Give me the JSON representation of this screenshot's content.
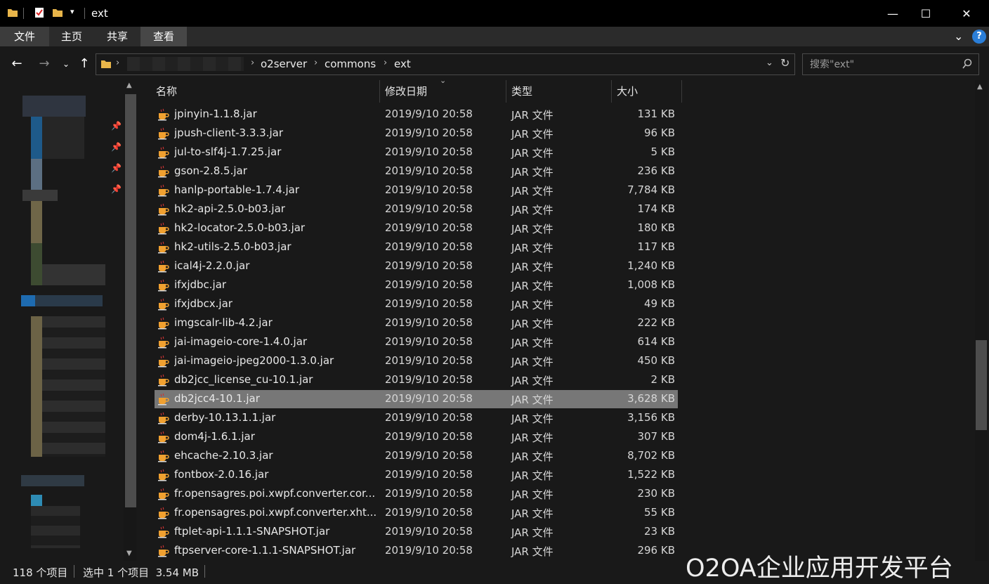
{
  "window": {
    "title": "ext",
    "minimize_glyph": "—",
    "maximize_glyph": "☐",
    "close_glyph": "✕"
  },
  "ribbon": {
    "tabs": [
      "文件",
      "主页",
      "共享",
      "查看"
    ],
    "active_index": 3,
    "help_glyph": "?"
  },
  "address": {
    "segments": [
      "o2server",
      "commons",
      "ext"
    ],
    "search_placeholder": "搜索\"ext\""
  },
  "columns": {
    "name": "名称",
    "date": "修改日期",
    "type": "类型",
    "size": "大小"
  },
  "files": [
    {
      "name": "jpinyin-1.1.8.jar",
      "date": "2019/9/10 20:58",
      "type": "JAR 文件",
      "size": "131 KB"
    },
    {
      "name": "jpush-client-3.3.3.jar",
      "date": "2019/9/10 20:58",
      "type": "JAR 文件",
      "size": "96 KB"
    },
    {
      "name": "jul-to-slf4j-1.7.25.jar",
      "date": "2019/9/10 20:58",
      "type": "JAR 文件",
      "size": "5 KB"
    },
    {
      "name": "gson-2.8.5.jar",
      "date": "2019/9/10 20:58",
      "type": "JAR 文件",
      "size": "236 KB"
    },
    {
      "name": "hanlp-portable-1.7.4.jar",
      "date": "2019/9/10 20:58",
      "type": "JAR 文件",
      "size": "7,784 KB"
    },
    {
      "name": "hk2-api-2.5.0-b03.jar",
      "date": "2019/9/10 20:58",
      "type": "JAR 文件",
      "size": "174 KB"
    },
    {
      "name": "hk2-locator-2.5.0-b03.jar",
      "date": "2019/9/10 20:58",
      "type": "JAR 文件",
      "size": "180 KB"
    },
    {
      "name": "hk2-utils-2.5.0-b03.jar",
      "date": "2019/9/10 20:58",
      "type": "JAR 文件",
      "size": "117 KB"
    },
    {
      "name": "ical4j-2.2.0.jar",
      "date": "2019/9/10 20:58",
      "type": "JAR 文件",
      "size": "1,240 KB"
    },
    {
      "name": "ifxjdbc.jar",
      "date": "2019/9/10 20:58",
      "type": "JAR 文件",
      "size": "1,008 KB"
    },
    {
      "name": "ifxjdbcx.jar",
      "date": "2019/9/10 20:58",
      "type": "JAR 文件",
      "size": "49 KB"
    },
    {
      "name": "imgscalr-lib-4.2.jar",
      "date": "2019/9/10 20:58",
      "type": "JAR 文件",
      "size": "222 KB"
    },
    {
      "name": "jai-imageio-core-1.4.0.jar",
      "date": "2019/9/10 20:58",
      "type": "JAR 文件",
      "size": "614 KB"
    },
    {
      "name": "jai-imageio-jpeg2000-1.3.0.jar",
      "date": "2019/9/10 20:58",
      "type": "JAR 文件",
      "size": "450 KB"
    },
    {
      "name": "db2jcc_license_cu-10.1.jar",
      "date": "2019/9/10 20:58",
      "type": "JAR 文件",
      "size": "2 KB"
    },
    {
      "name": "db2jcc4-10.1.jar",
      "date": "2019/9/10 20:58",
      "type": "JAR 文件",
      "size": "3,628 KB",
      "selected": true
    },
    {
      "name": "derby-10.13.1.1.jar",
      "date": "2019/9/10 20:58",
      "type": "JAR 文件",
      "size": "3,156 KB"
    },
    {
      "name": "dom4j-1.6.1.jar",
      "date": "2019/9/10 20:58",
      "type": "JAR 文件",
      "size": "307 KB"
    },
    {
      "name": "ehcache-2.10.3.jar",
      "date": "2019/9/10 20:58",
      "type": "JAR 文件",
      "size": "8,702 KB"
    },
    {
      "name": "fontbox-2.0.16.jar",
      "date": "2019/9/10 20:58",
      "type": "JAR 文件",
      "size": "1,522 KB"
    },
    {
      "name": "fr.opensagres.poi.xwpf.converter.cor...",
      "date": "2019/9/10 20:58",
      "type": "JAR 文件",
      "size": "230 KB"
    },
    {
      "name": "fr.opensagres.poi.xwpf.converter.xht...",
      "date": "2019/9/10 20:58",
      "type": "JAR 文件",
      "size": "55 KB"
    },
    {
      "name": "ftplet-api-1.1.1-SNAPSHOT.jar",
      "date": "2019/9/10 20:58",
      "type": "JAR 文件",
      "size": "23 KB"
    },
    {
      "name": "ftpserver-core-1.1.1-SNAPSHOT.jar",
      "date": "2019/9/10 20:58",
      "type": "JAR 文件",
      "size": "296 KB"
    }
  ],
  "status": {
    "count": "118 个项目",
    "selection": "选中 1 个项目  3.54 MB"
  },
  "watermark": "O2OA企业应用开发平台",
  "colors": {
    "background": "#191919",
    "selection": "#777777",
    "titlebar": "#000000",
    "folder": "#e8b54a",
    "jar_cup": "#f0a030"
  },
  "icons": {
    "file": "jar-file-icon",
    "folder": "folder-icon",
    "pin": "pin-icon"
  }
}
